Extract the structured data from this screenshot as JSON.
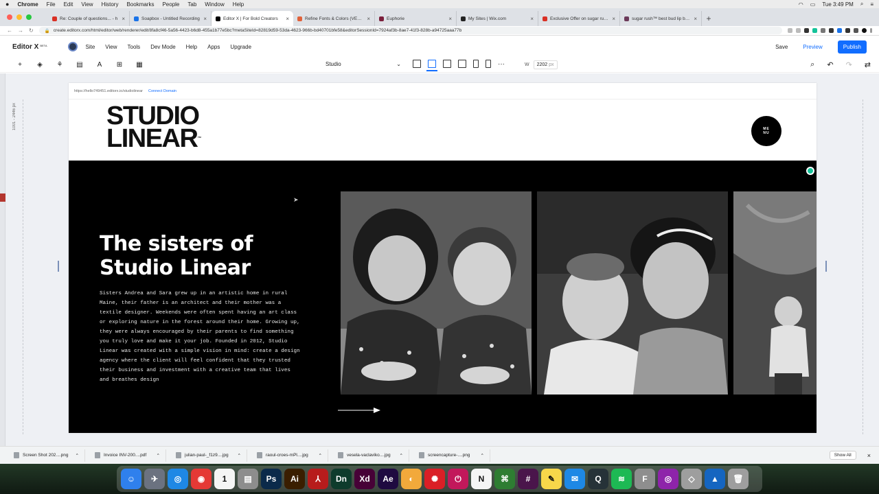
{
  "mac_menubar": {
    "app": "Chrome",
    "items": [
      "File",
      "Edit",
      "View",
      "History",
      "Bookmarks",
      "People",
      "Tab",
      "Window",
      "Help"
    ],
    "clock": "Tue 3:49 PM"
  },
  "tabs": [
    {
      "label": "Re: Couple of questions... - h",
      "color": "#d93025"
    },
    {
      "label": "Soapbox - Untitled Recording",
      "color": "#1a73e8"
    },
    {
      "label": "Editor X | For Bold Creators",
      "color": "#000000",
      "active": true
    },
    {
      "label": "Refine Fonts & Colors (VERY IM",
      "color": "#e0623b"
    },
    {
      "label": "Euphorie",
      "color": "#7b1f3b"
    },
    {
      "label": "My Sites | Wix.com",
      "color": "#222222"
    },
    {
      "label": "Exclusive Offer on sugar rush™",
      "color": "#d93025"
    },
    {
      "label": "sugar rush™ best bud lip butte",
      "color": "#6c3a5a"
    }
  ],
  "address_bar": {
    "url": "create.editorx.com/html/editor/web/renderer/edit/8fa8cf46-5a56-4423-b6d8-455a1b77e5bc?metaSiteId=82819d59-53da-4623-966b-bd40701bfe58&editorSessionId=7924af3b-8ae7-41f3-828b-a94725aaa77b"
  },
  "editor": {
    "brand": "Editor X",
    "brand_tag": "BETA",
    "menu": [
      "Site",
      "View",
      "Tools",
      "Dev Mode",
      "Help",
      "Apps",
      "Upgrade"
    ],
    "save": "Save",
    "preview": "Preview",
    "publish": "Publish",
    "breakpoint": "Studio",
    "width_label": "W",
    "width_value": "2202",
    "width_unit": "px",
    "ruler_text": "1001 - 2446 px",
    "accent_color": "#116dff"
  },
  "site": {
    "page_url": "https://hello749451.editorx.io/studiolinear",
    "connect_domain": "Connect Domain",
    "logo_line1": "STUDIO",
    "logo_line2": "LINEAR",
    "logo_tm": "™",
    "menu_line1": "ME",
    "menu_line2": "NU",
    "heading": "The sisters of Studio Linear",
    "body": "Sisters Andrea and Sara grew up in an artistic home in rural Maine, their father is an architect and their mother was a textile designer. Weekends were often spent having an art class or exploring nature in the forest around their home. Growing up, they were always encouraged by their parents to find something you truly love and make it your job. Founded in 2012, Studio Linear was created with a simple vision in mind: create a design agency where the client will feel confident that they trusted their business and investment with a creative team that lives and breathes design",
    "gallery": [
      "two-sisters-photo",
      "sisters-portrait-photo",
      "child-outdoor-photo"
    ]
  },
  "downloads": [
    "Screen Shot 202....png",
    "Invoice INV-200....pdf",
    "julian-paul-_f1z9....jpg",
    "raoul-croes-mPl....jpg",
    "vesela-vaclaviko....jpg",
    "screencapture-....png"
  ],
  "show_all": "Show All",
  "dock": [
    {
      "name": "finder-icon",
      "glyph": "☺",
      "color": "#2f80ed"
    },
    {
      "name": "launchpad-icon",
      "glyph": "✈",
      "color": "#6b7280"
    },
    {
      "name": "safari-icon",
      "glyph": "◎",
      "color": "#1e88e5"
    },
    {
      "name": "chrome-icon",
      "glyph": "◉",
      "color": "#e53935"
    },
    {
      "name": "calendar-icon",
      "glyph": "1",
      "color": "#f5f5f5"
    },
    {
      "name": "archive-icon",
      "glyph": "▤",
      "color": "#8d8d8d"
    },
    {
      "name": "photoshop-icon",
      "glyph": "Ps",
      "color": "#0b2a4a"
    },
    {
      "name": "illustrator-icon",
      "glyph": "Ai",
      "color": "#3a1e00"
    },
    {
      "name": "acrobat-icon",
      "glyph": "⅄",
      "color": "#b71c1c"
    },
    {
      "name": "dimension-icon",
      "glyph": "Dn",
      "color": "#0e3b2c"
    },
    {
      "name": "xd-icon",
      "glyph": "Xd",
      "color": "#470137"
    },
    {
      "name": "after-effects-icon",
      "glyph": "Ae",
      "color": "#1f0a40"
    },
    {
      "name": "preview-icon",
      "glyph": "◐",
      "color": "#f2a93b"
    },
    {
      "name": "creative-cloud-icon",
      "glyph": "✺",
      "color": "#da1f26"
    },
    {
      "name": "power-icon",
      "glyph": "⏻",
      "color": "#c2185b"
    },
    {
      "name": "notion-icon",
      "glyph": "N",
      "color": "#f5f5f5"
    },
    {
      "name": "terminal-icon",
      "glyph": "⌘",
      "color": "#2e7d32"
    },
    {
      "name": "slack-icon",
      "glyph": "#",
      "color": "#4a154b"
    },
    {
      "name": "notes-icon",
      "glyph": "✎",
      "color": "#f7d74a"
    },
    {
      "name": "messenger-icon",
      "glyph": "✉",
      "color": "#1e88e5"
    },
    {
      "name": "quicktime-icon",
      "glyph": "Q",
      "color": "#263238"
    },
    {
      "name": "spotify-icon",
      "glyph": "≋",
      "color": "#1db954"
    },
    {
      "name": "font-icon",
      "glyph": "F",
      "color": "#8e8e8e"
    },
    {
      "name": "podcasts-icon",
      "glyph": "◎",
      "color": "#8e24aa"
    },
    {
      "name": "roblox-icon",
      "glyph": "◇",
      "color": "#9e9e9e"
    },
    {
      "name": "xcode-icon",
      "glyph": "▲",
      "color": "#1565c0"
    },
    {
      "name": "trash-icon",
      "glyph": "🗑",
      "color": "#9e9e9e"
    }
  ]
}
